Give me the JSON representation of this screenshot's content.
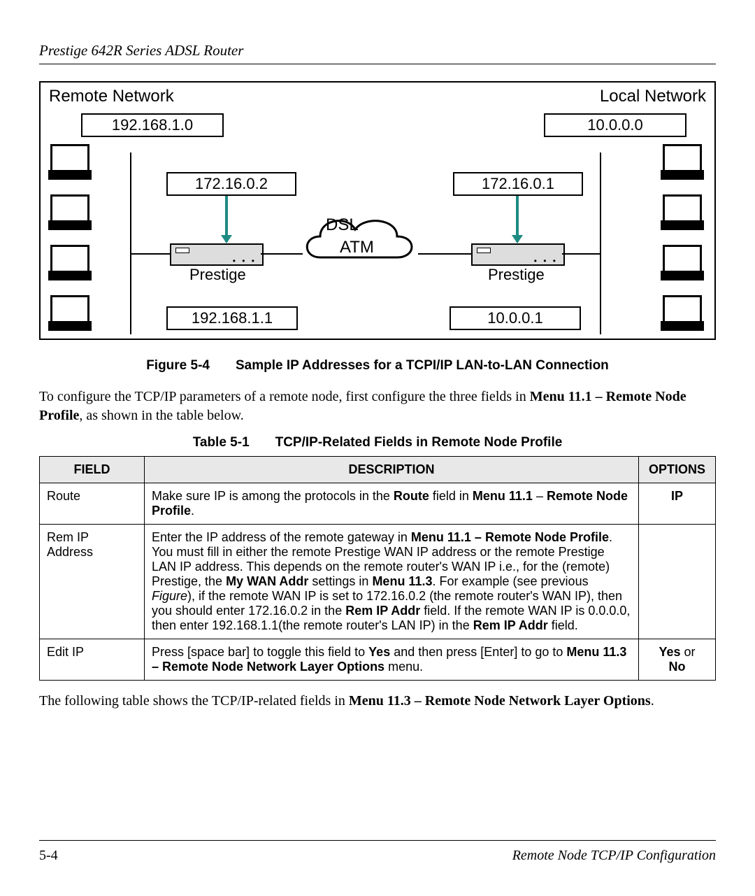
{
  "running_head": "Prestige 642R Series ADSL Router",
  "diagram": {
    "remote_title": "Remote Network",
    "local_title": "Local Network",
    "remote_subnet": "192.168.1.0",
    "local_subnet": "10.0.0.0",
    "remote_wan_ip": "172.16.0.2",
    "local_wan_ip": "172.16.0.1",
    "remote_host_ip": "192.168.1.1",
    "local_host_ip": "10.0.0.1",
    "router_label": "Prestige",
    "cloud_top": "DSL",
    "cloud_bottom": "ATM"
  },
  "figure_caption_prefix": "Figure 5-4",
  "figure_caption_text": "Sample IP Addresses for a TCPI/IP LAN-to-LAN Connection",
  "intro_para_1a": "To configure the TCP/IP parameters of a remote node, first configure the three fields in ",
  "intro_para_1b": "Menu 11.1 – Remote Node Profile",
  "intro_para_1c": ", as shown in the table below.",
  "table_caption_prefix": "Table 5-1",
  "table_caption_text": "TCP/IP-Related Fields in Remote Node Profile",
  "columns": {
    "field": "FIELD",
    "desc": "DESCRIPTION",
    "opt": "OPTIONS"
  },
  "rows": [
    {
      "field": "Route",
      "desc_html": "Make sure IP is among the protocols in the <b>Route</b> field in <b>Menu 11.1</b> – <b>Remote Node Profile</b>.",
      "opt_html": "IP"
    },
    {
      "field": "Rem IP Address",
      "desc_html": "Enter the IP address of the remote gateway in <b>Menu 11.1 – Remote Node Profile</b>. You must fill in either the remote Prestige WAN IP address or the remote Prestige LAN IP address. This depends on the remote router's WAN IP i.e., for the (remote) Prestige, the <b>My WAN Addr</b> settings in <b>Menu 11.3</b>. For example (see previous <i>Figure</i>), if the remote WAN IP is set to 172.16.0.2 (the remote router's WAN IP), then you should enter 172.16.0.2 in the <b>Rem IP Addr</b> field.  If the remote WAN IP is 0.0.0.0, then enter 192.168.1.1(the remote router's LAN IP) in the <b>Rem IP Addr</b> field.",
      "opt_html": ""
    },
    {
      "field": "Edit IP",
      "desc_html": "Press [space bar] to toggle this field to <b>Yes</b> and then press [Enter] to go to <b>Menu 11.3 – Remote Node Network Layer Options</b> menu.",
      "opt_html": "<b>Yes</b> <span class='or'>or</span><br><b>No</b>"
    }
  ],
  "outro_a": "The following table shows the TCP/IP-related fields in ",
  "outro_b": "Menu 11.3 – Remote Node Network Layer Options",
  "outro_c": ".",
  "page_number": "5-4",
  "section_title": "Remote Node TCP/IP Configuration"
}
